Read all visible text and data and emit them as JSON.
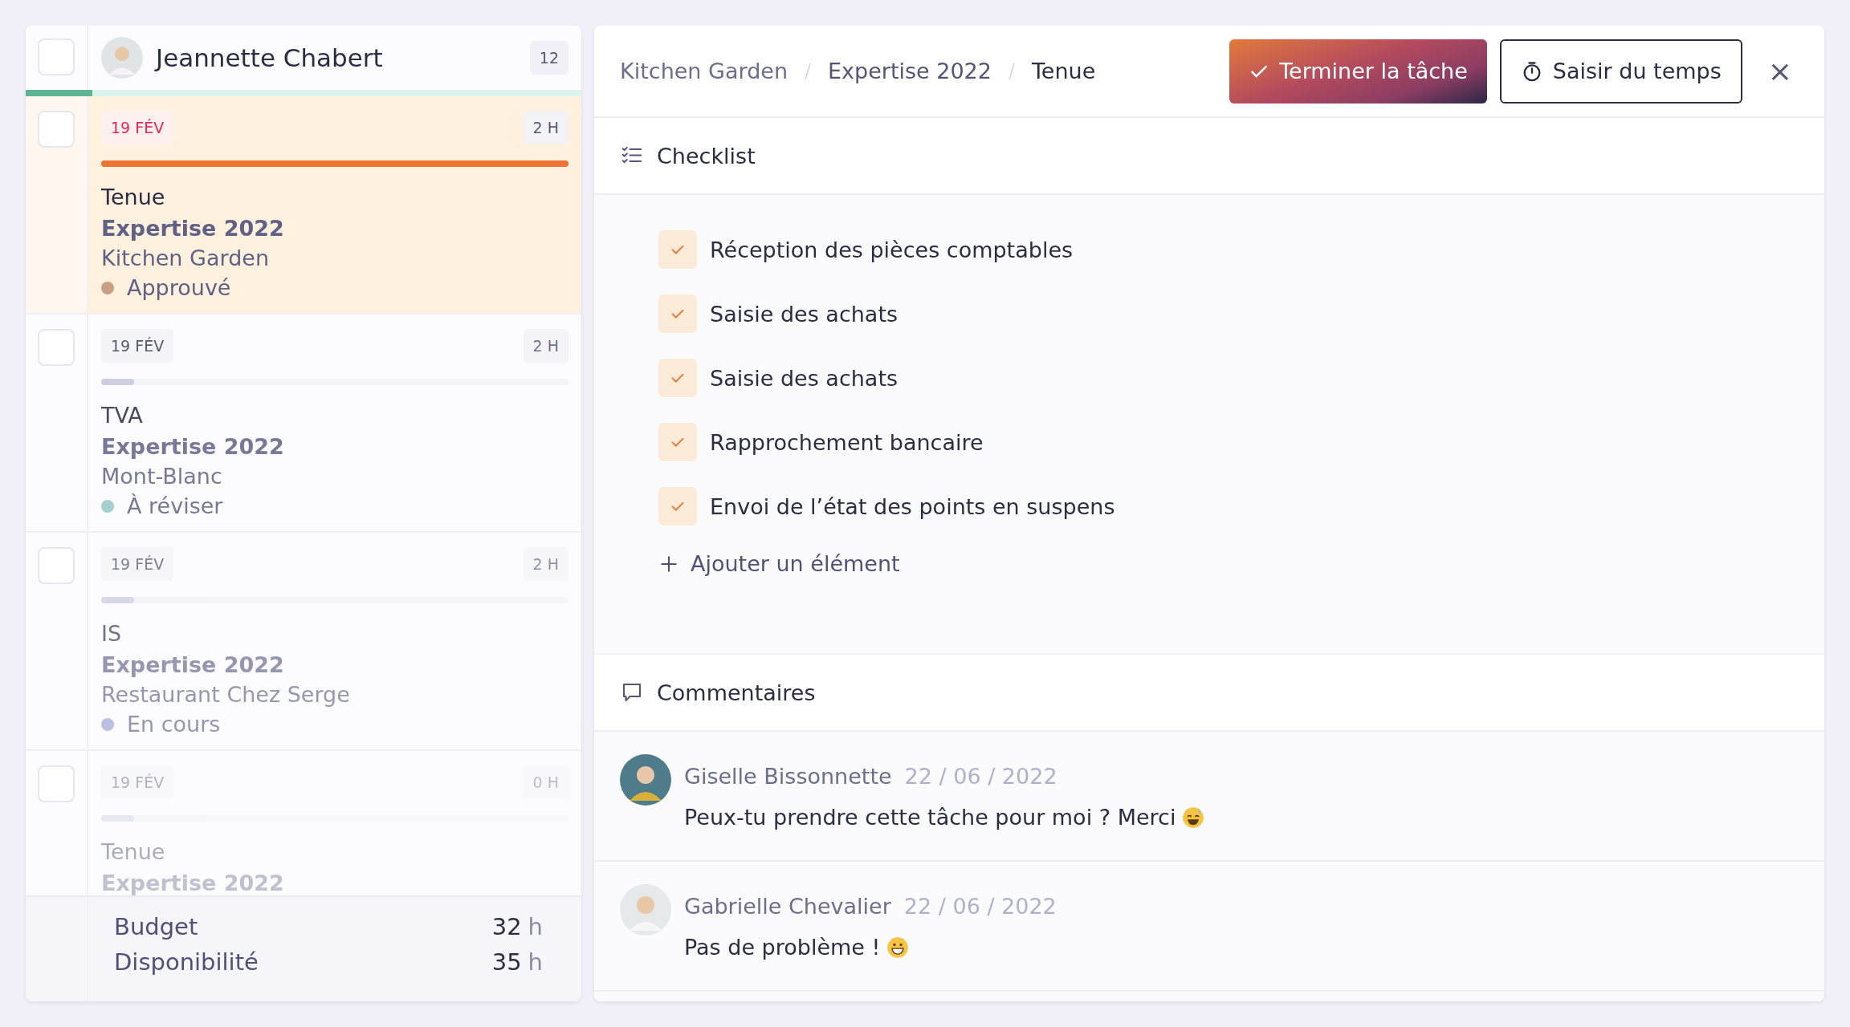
{
  "user": {
    "name": "Jeannette Chabert",
    "count": "12",
    "level": 0.12,
    "checked": false
  },
  "tasks": [
    {
      "date": "19 FÉV",
      "hours": "2 H",
      "level": 1,
      "title": "Tenue",
      "project": "Expertise 2022",
      "client": "Kitchen Garden",
      "status": "Approuvé",
      "color": "#c9a085",
      "selected": true,
      "checked": false
    },
    {
      "date": "19 FÉV",
      "hours": "2 H",
      "level": 0.07,
      "title": "TVA",
      "project": "Expertise 2022",
      "client": "Mont-Blanc",
      "status": "À réviser",
      "color": "#a3cfcf",
      "selected": false,
      "checked": false
    },
    {
      "date": "19 FÉV",
      "hours": "2 H",
      "level": 0.07,
      "title": "IS",
      "project": "Expertise 2022",
      "client": "Restaurant Chez Serge",
      "status": "En cours",
      "color": "#bcc0e0",
      "selected": false,
      "checked": false
    },
    {
      "date": "19 FÉV",
      "hours": "0 H",
      "level": 0.07,
      "title": "Tenue",
      "project": "Expertise 2022",
      "selected": false,
      "checked": false
    }
  ],
  "summary": [
    {
      "label": "Budget",
      "value": "32",
      "unit": "h"
    },
    {
      "label": "Disponibilité",
      "value": "35",
      "unit": "h"
    }
  ],
  "breadcrumb": [
    "Kitchen Garden",
    "Expertise 2022",
    "Tenue"
  ],
  "actions": {
    "complete": "Terminer la tâche",
    "time": "Saisir du temps",
    "close": "×"
  },
  "checklist": {
    "title": "Checklist",
    "items": [
      {
        "label": "Réception des pièces comptables",
        "checked": true
      },
      {
        "label": "Saisie des achats",
        "checked": true
      },
      {
        "label": "Saisie des achats",
        "checked": true
      },
      {
        "label": "Rapprochement bancaire",
        "checked": true
      },
      {
        "label": "Envoi de l’état des points en suspens",
        "checked": true
      }
    ],
    "add": "Ajouter un élément"
  },
  "comments": {
    "title": "Commentaires",
    "items": [
      {
        "author": "Giselle Bissonnette",
        "date": "22 / 06 / 2022",
        "text": "Peux-tu prendre cette tâche pour moi ? Merci"
      },
      {
        "author": "Gabrielle Chevalier",
        "date": "22 / 06 / 2022",
        "text": "Pas de problème !"
      }
    ]
  }
}
